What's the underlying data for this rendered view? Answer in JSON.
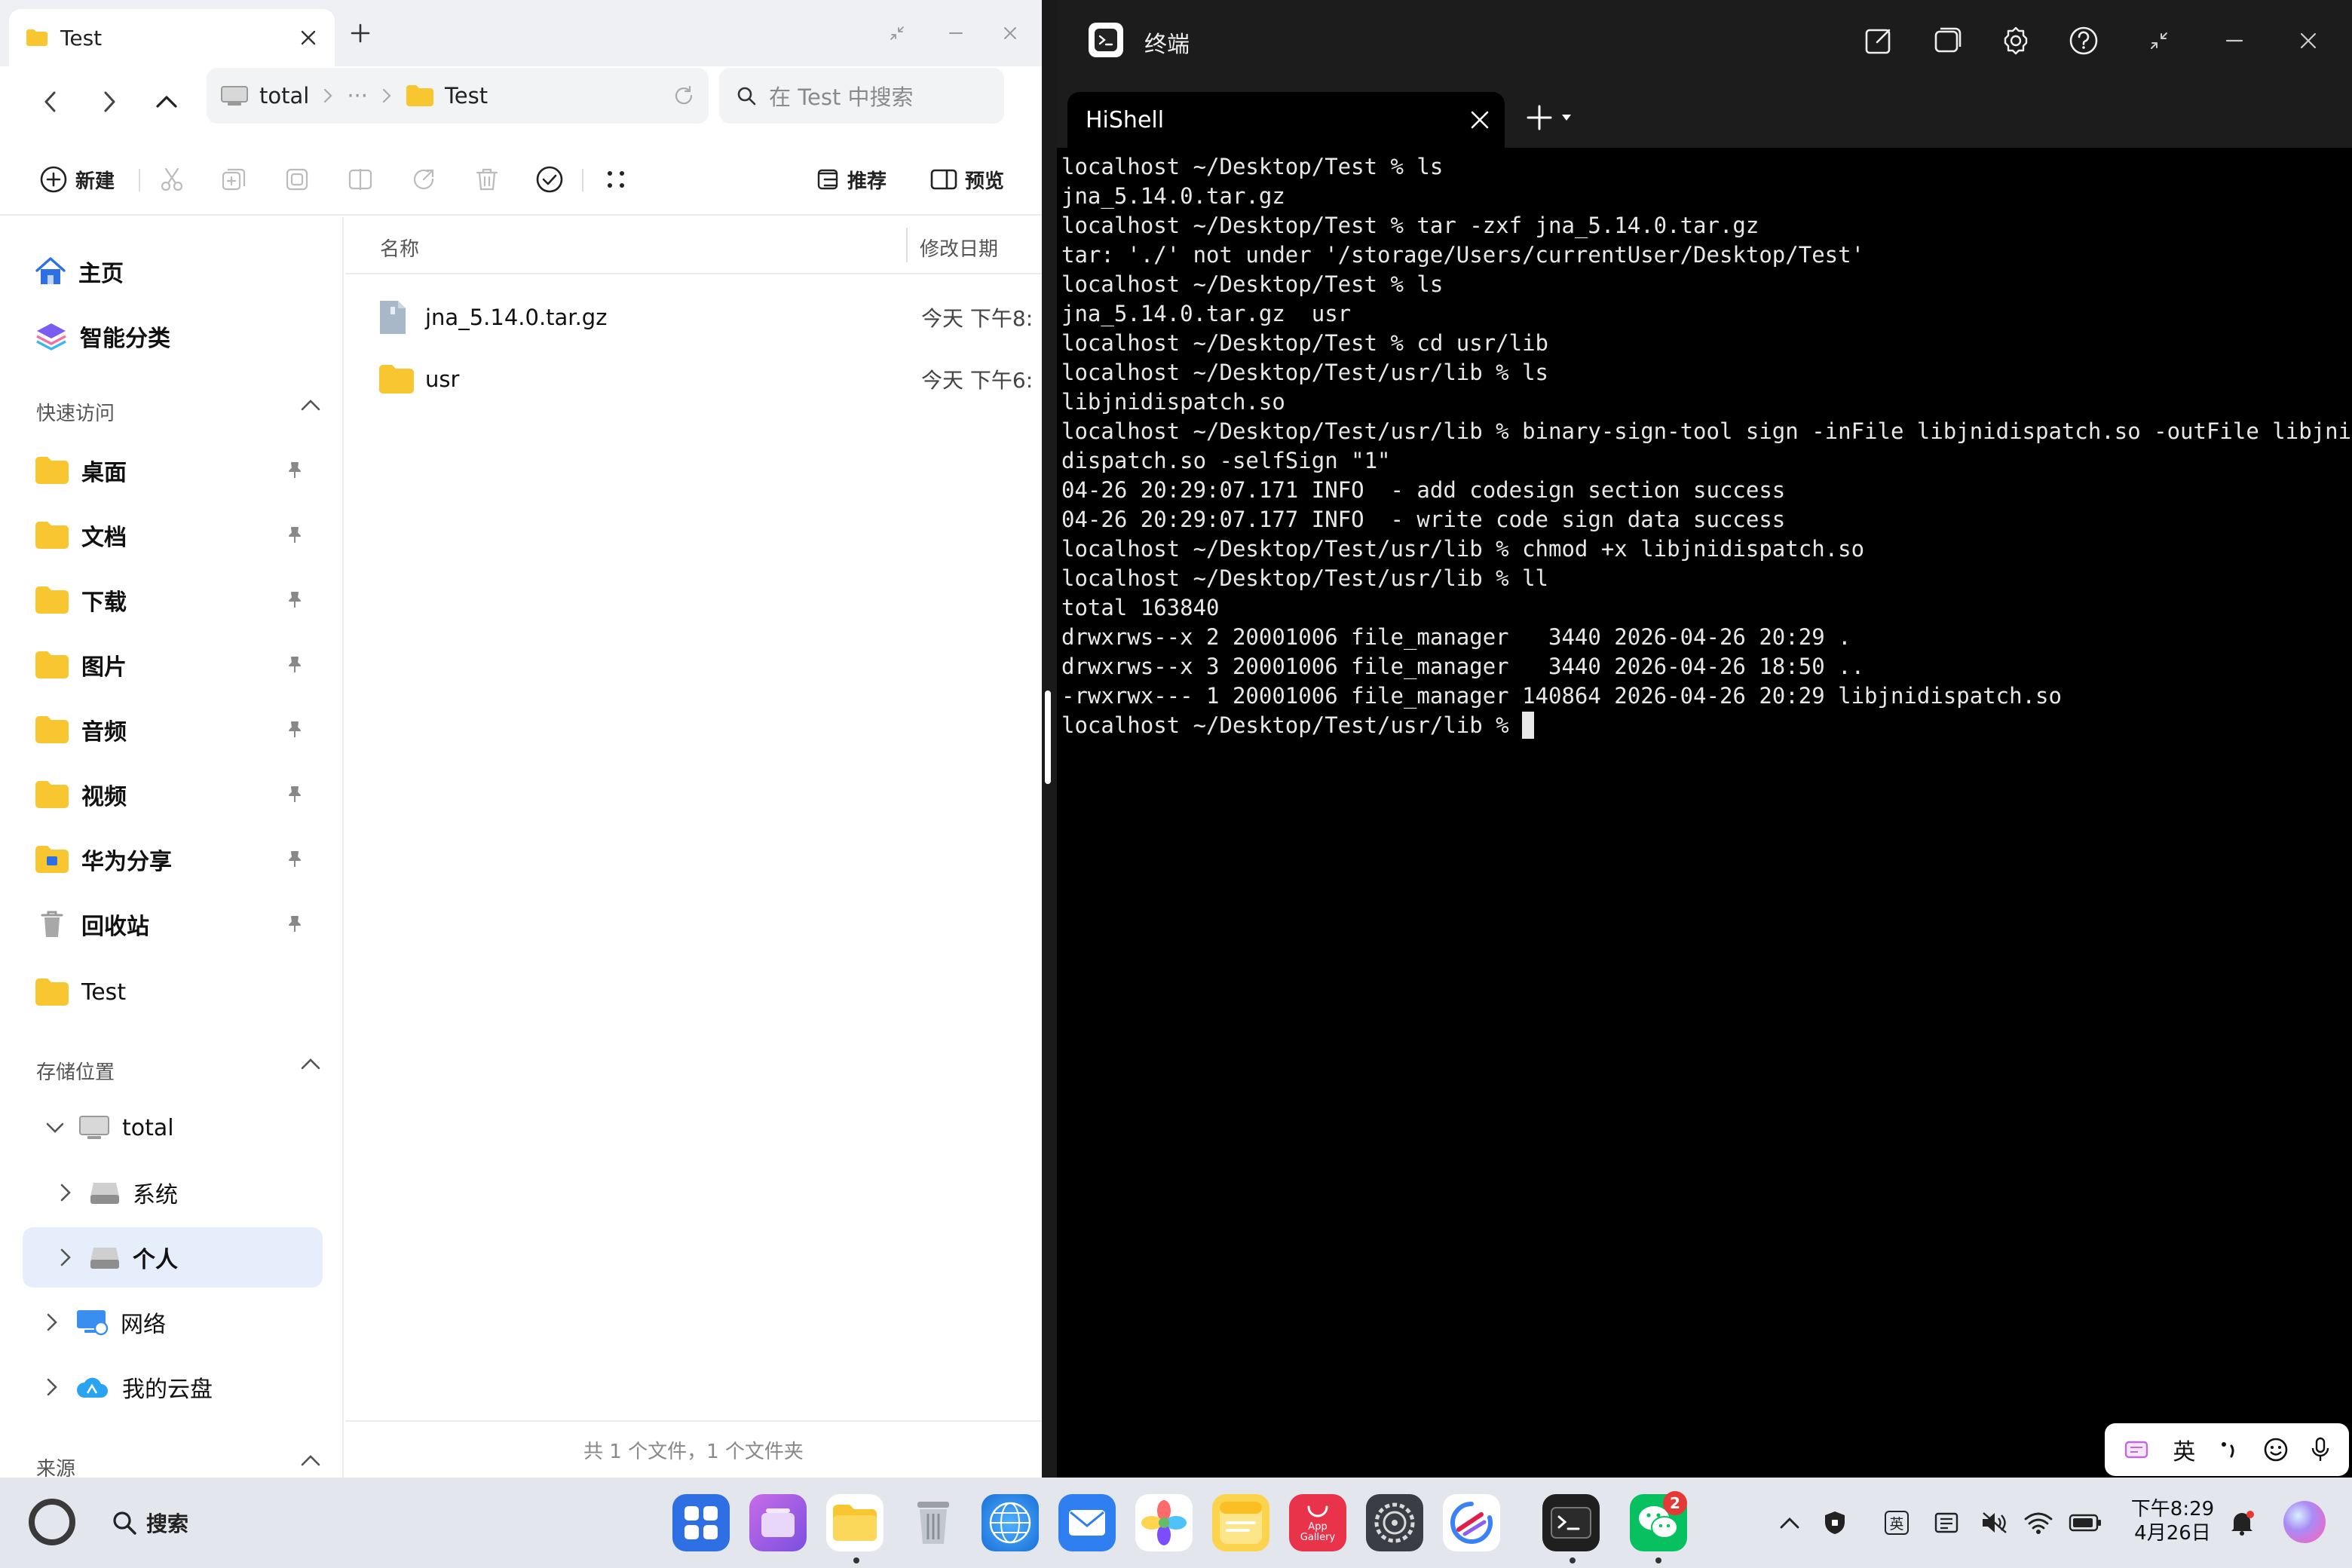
{
  "file_manager": {
    "tab_title": "Test",
    "address": {
      "root": "total",
      "ellipsis": "···",
      "current": "Test"
    },
    "search_placeholder": "在 Test 中搜索",
    "toolbar": {
      "new_label": "新建",
      "recommend_label": "推荐",
      "preview_label": "预览"
    },
    "sidebar": {
      "home": "主页",
      "smart": "智能分类",
      "quick_access_title": "快速访问",
      "quick_access": [
        "桌面",
        "文档",
        "下载",
        "图片",
        "音频",
        "视频",
        "华为分享",
        "回收站",
        "Test"
      ],
      "storage_title": "存储位置",
      "storage": {
        "total": "total",
        "system": "系统",
        "personal": "个人",
        "network": "网络",
        "cloud": "我的云盘"
      },
      "sources_title": "来源"
    },
    "columns": {
      "name": "名称",
      "modified": "修改日期"
    },
    "files": [
      {
        "name": "jna_5.14.0.tar.gz",
        "date": "今天 下午8:"
      },
      {
        "name": "usr",
        "date": "今天 下午6:"
      }
    ],
    "footer": "共 1 个文件，1 个文件夹"
  },
  "terminal": {
    "title": "终端",
    "tab": "HiShell",
    "lines": [
      "localhost ~/Desktop/Test % ls",
      "jna_5.14.0.tar.gz",
      "localhost ~/Desktop/Test % tar -zxf jna_5.14.0.tar.gz",
      "tar: './' not under '/storage/Users/currentUser/Desktop/Test'",
      "localhost ~/Desktop/Test % ls",
      "jna_5.14.0.tar.gz  usr",
      "localhost ~/Desktop/Test % cd usr/lib",
      "localhost ~/Desktop/Test/usr/lib % ls",
      "libjnidispatch.so",
      "localhost ~/Desktop/Test/usr/lib % binary-sign-tool sign -inFile libjnidispatch.so -outFile libjni",
      "dispatch.so -selfSign \"1\"",
      "04-26 20:29:07.171 INFO  - add codesign section success",
      "04-26 20:29:07.177 INFO  - write code sign data success",
      "localhost ~/Desktop/Test/usr/lib % chmod +x libjnidispatch.so",
      "localhost ~/Desktop/Test/usr/lib % ll",
      "total 163840",
      "drwxrws--x 2 20001006 file_manager   3440 2026-04-26 20:29 .",
      "drwxrws--x 3 20001006 file_manager   3440 2026-04-26 18:50 ..",
      "-rwxrwx--- 1 20001006 file_manager 140864 2026-04-26 20:29 libjnidispatch.so"
    ],
    "prompt": "localhost ~/Desktop/Test/usr/lib % "
  },
  "ime": {
    "lang": "英"
  },
  "taskbar": {
    "search_label": "搜索",
    "app_gallery_text": "App Gallery",
    "wechat_badge": "2",
    "tray_lang": "英",
    "time": "下午8:29",
    "date": "4月26日"
  },
  "colors": {
    "accent_blue": "#2f6fe4",
    "folder_yellow": "#f8c630",
    "terminal_bg": "#000000",
    "terminal_fg": "#e8e8e8",
    "active_item_bg": "#e6eefb"
  }
}
